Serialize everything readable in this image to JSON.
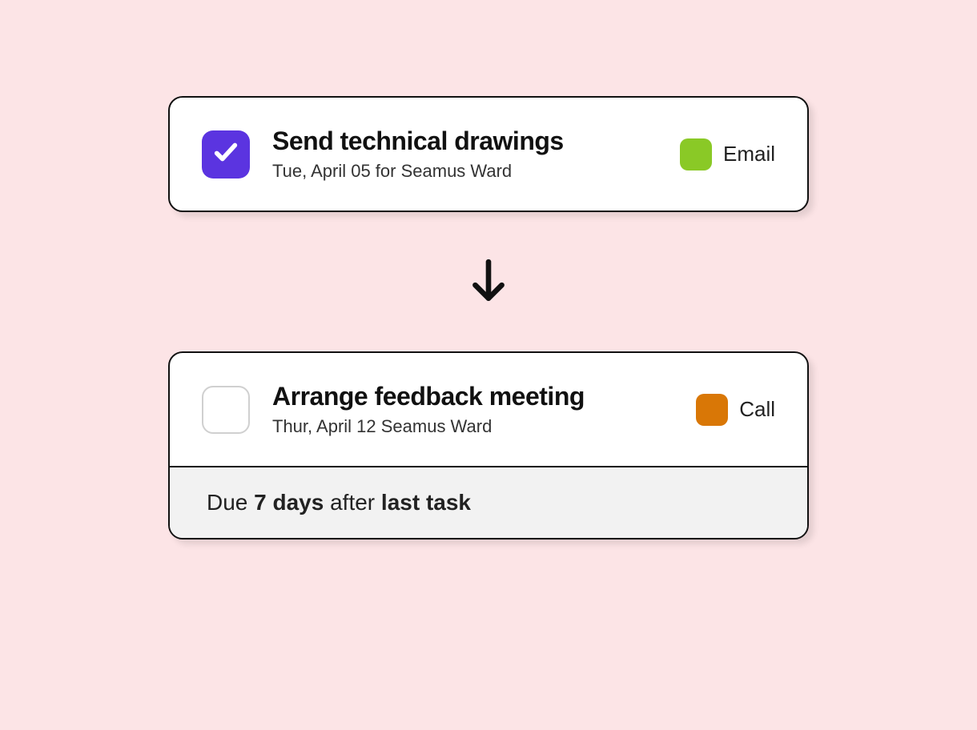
{
  "tasks": [
    {
      "title": "Send technical drawings",
      "subtitle": "Tue, April 05 for Seamus Ward",
      "checked": true,
      "tag": {
        "label": "Email",
        "color": "#8ac926"
      }
    },
    {
      "title": "Arrange feedback meeting",
      "subtitle": "Thur, April 12 Seamus Ward",
      "checked": false,
      "tag": {
        "label": "Call",
        "color": "#d97706"
      },
      "due_rule": {
        "prefix": "Due ",
        "days": "7 days",
        "middle": " after ",
        "anchor": "last task"
      }
    }
  ]
}
